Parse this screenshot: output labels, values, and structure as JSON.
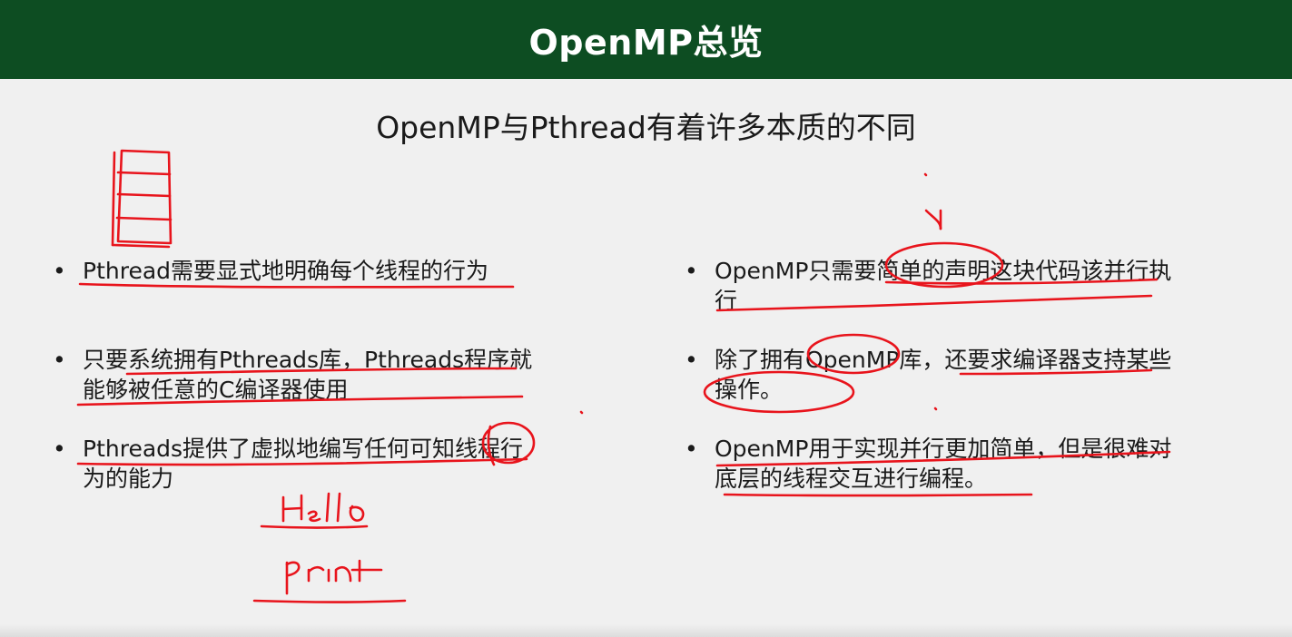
{
  "slide": {
    "title": "OpenMP总览",
    "subtitle": "OpenMP与Pthread有着许多本质的不同"
  },
  "left_bullets": [
    {
      "bullet": "•",
      "text": "Pthread需要显式地明确每个线程的行为"
    },
    {
      "bullet": "•",
      "text": "只要系统拥有Pthreads库，Pthreads程序就能够被任意的C编译器使用"
    },
    {
      "bullet": "•",
      "text": "Pthreads提供了虚拟地编写任何可知线程行为的能力"
    }
  ],
  "right_bullets": [
    {
      "bullet": "•",
      "text": "OpenMP只需要简单的声明这块代码该并行执行"
    },
    {
      "bullet": "•",
      "text": "除了拥有OpenMP库，还要求编译器支持某些操作。"
    },
    {
      "bullet": "•",
      "text": "OpenMP用于实现并行更加简单，但是很难对底层的线程交互进行编程。"
    }
  ],
  "handwriting": {
    "word_1": "Hello",
    "word_2": "print"
  },
  "colors": {
    "title_bar": "#0d4d22",
    "background": "#f0f0f0",
    "ink": "#e8141c"
  }
}
